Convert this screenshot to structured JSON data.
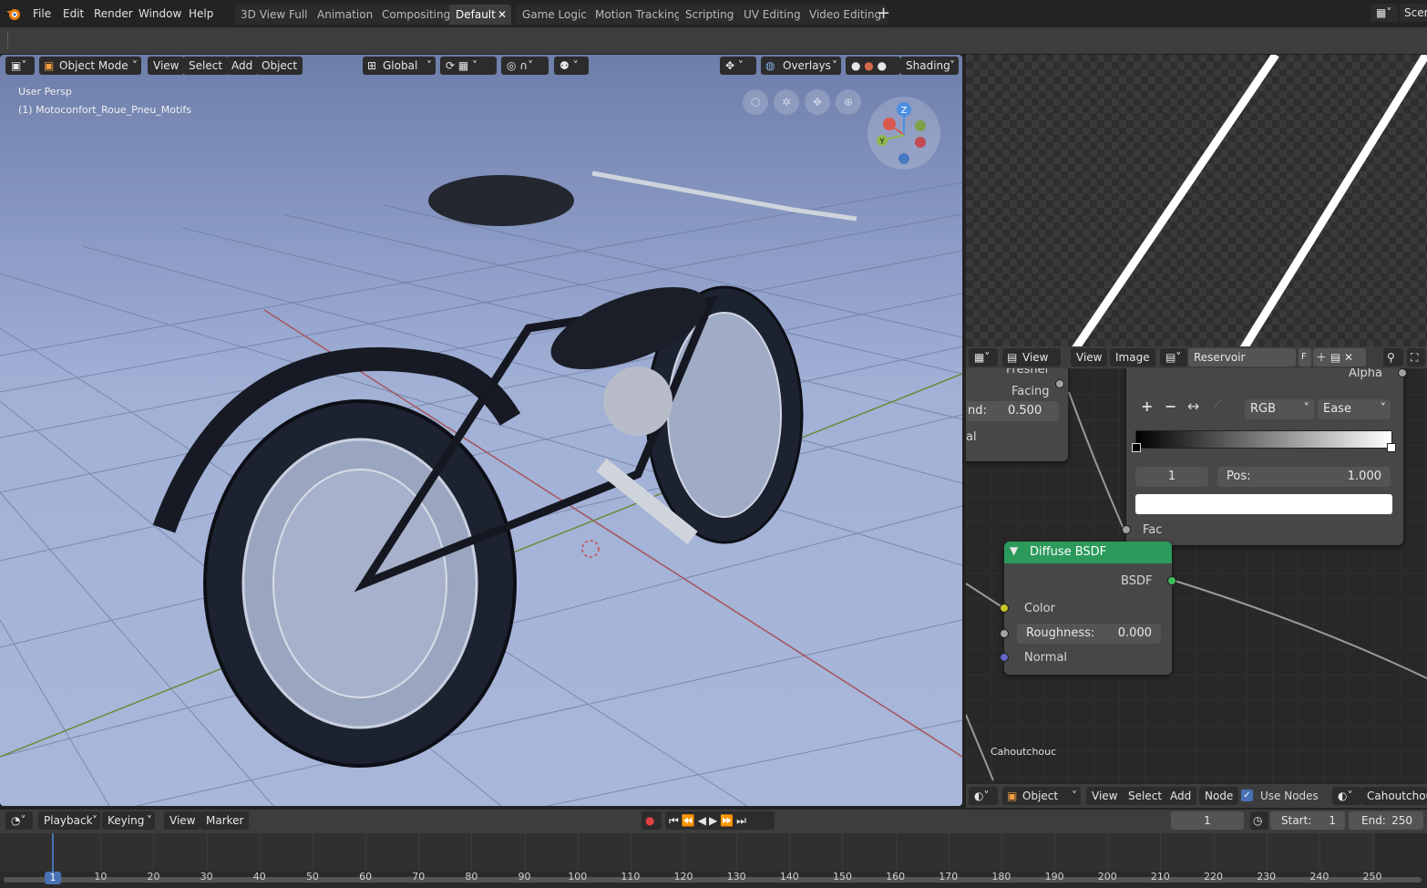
{
  "topbar": {
    "menus": [
      "File",
      "Edit",
      "Render",
      "Window",
      "Help"
    ],
    "workspaces": [
      "3D View Full",
      "Animation",
      "Compositing",
      "Default",
      "Game Logic",
      "Motion Tracking",
      "Scripting",
      "UV Editing",
      "Video Editing"
    ],
    "active_workspace": "Default",
    "scene_label": "Scen"
  },
  "viewport": {
    "mode": "Object Mode",
    "menu": [
      "View",
      "Select",
      "Add",
      "Object"
    ],
    "transform": "Global",
    "overlays": "Overlays",
    "shading": "Shading",
    "info_line1": "User Persp",
    "info_line2": "(1) Motoconfort_Roue_Pneu_Motifs",
    "gizmo_axes": {
      "z": "Z",
      "y": "Y"
    }
  },
  "image_editor": {
    "view_label": "View",
    "menu": [
      "View",
      "Image"
    ],
    "image_name": "Reservoir",
    "fake_user": "F"
  },
  "node_editor": {
    "left_node": {
      "fresnel": "Fresnel",
      "facing": "Facing",
      "blend_label": "nd:",
      "blend_value": "0.500",
      "out": "al"
    },
    "ramp_node": {
      "alpha": "Alpha",
      "mode": "RGB",
      "interp": "Ease",
      "index": "1",
      "pos_label": "Pos:",
      "pos_value": "1.000",
      "fac": "Fac"
    },
    "diffuse": {
      "title": "Diffuse BSDF",
      "out": "BSDF",
      "color": "Color",
      "rough_label": "Roughness:",
      "rough_value": "0.000",
      "normal": "Normal"
    },
    "frame_label": "Cahoutchouc",
    "header": {
      "type": "Object",
      "menu": [
        "View",
        "Select",
        "Add",
        "Node"
      ],
      "use_nodes": "Use Nodes",
      "material": "Cahoutchouc"
    }
  },
  "timeline": {
    "menu": [
      "Playback",
      "Keying",
      "View",
      "Marker"
    ],
    "current_frame": "1",
    "start_label": "Start:",
    "start": "1",
    "end_label": "End:",
    "end": "250",
    "ticks": [
      "10",
      "20",
      "30",
      "40",
      "50",
      "60",
      "70",
      "80",
      "90",
      "100",
      "110",
      "120",
      "130",
      "140",
      "150",
      "160",
      "170",
      "180",
      "190",
      "200",
      "210",
      "220",
      "230",
      "240",
      "250"
    ],
    "frame_marker": "1"
  },
  "colors": {
    "accent": "#4772b3",
    "node_header_green": "#2b9a5b",
    "x_axis": "#d8584e",
    "y_axis": "#8fb94c",
    "z_axis": "#4a8ee0"
  }
}
